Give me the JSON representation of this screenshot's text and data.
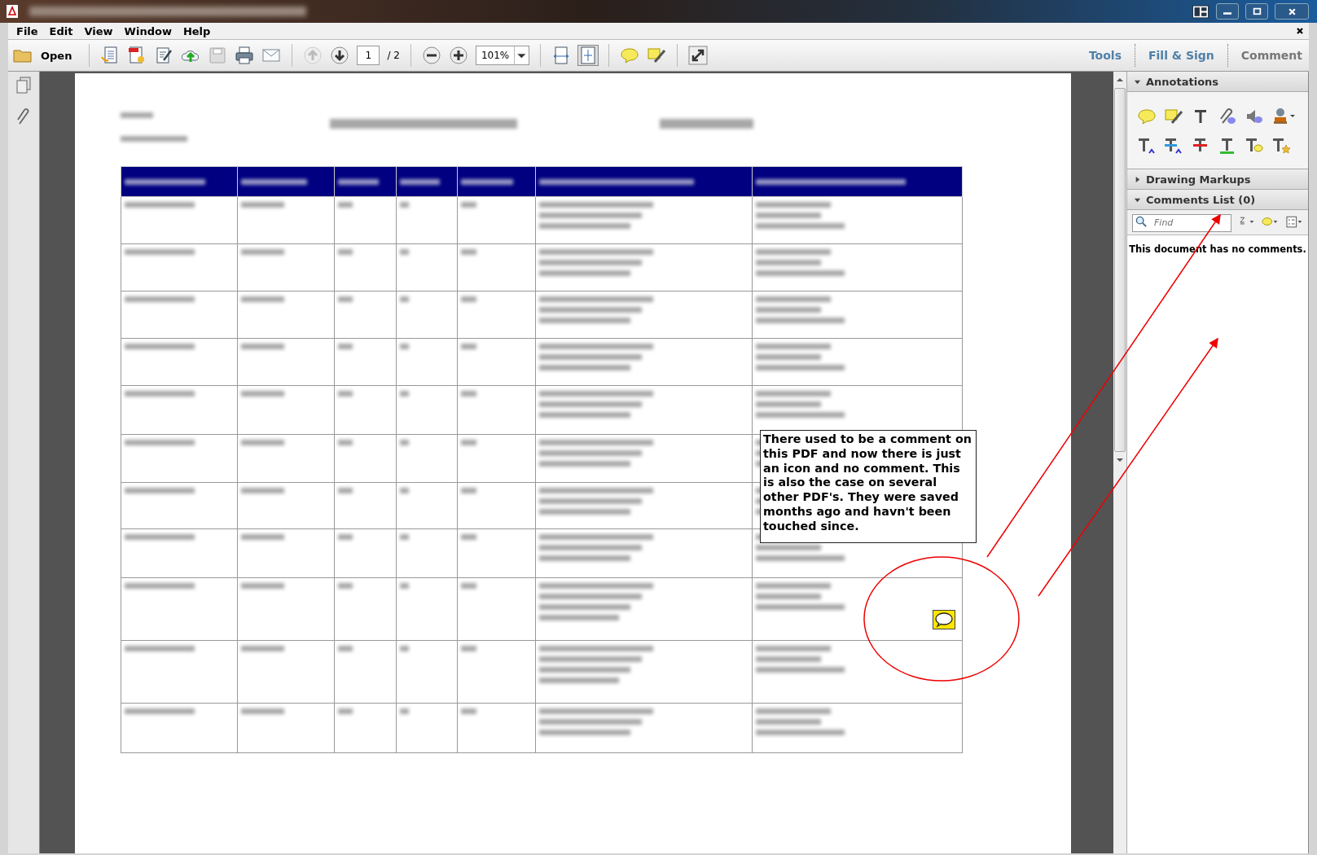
{
  "menu": [
    "File",
    "Edit",
    "View",
    "Window",
    "Help"
  ],
  "toolbar": {
    "open_label": "Open",
    "page_number": "1",
    "page_total": "/ 2",
    "zoom": "101%"
  },
  "tabs": [
    {
      "label": "Tools"
    },
    {
      "label": "Fill & Sign"
    },
    {
      "label": "Comment"
    }
  ],
  "panel": {
    "sections": [
      {
        "title": "Annotations",
        "expanded": true
      },
      {
        "title": "Drawing Markups",
        "expanded": false
      },
      {
        "title": "Comments List (0)",
        "expanded": true
      }
    ],
    "find": {
      "placeholder": "Find"
    },
    "empty_message": "This document has no comments."
  },
  "callout": {
    "text": "There used to be a comment on this PDF and now there is just an icon and no comment. This is also the case on several other PDF's. They were saved months ago and havn't been touched since."
  }
}
